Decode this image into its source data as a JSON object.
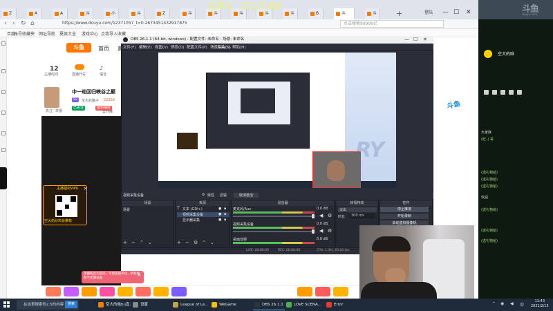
{
  "browser": {
    "tabs": [
      "Z",
      "A",
      "A",
      "斗",
      "小",
      "斗",
      "Z",
      "斗",
      "斗",
      "斗",
      "斗",
      "斗",
      "B",
      "斗",
      "斗"
    ],
    "active_tab": "斗",
    "banner": "在漂店，进几天回家",
    "login_label": "登陆",
    "url": "https://www.douyu.com/12371057_t=0.2673451432917875",
    "search_placeholder": "点击搜索99999亿",
    "bookmarks": [
      "百度",
      "账号收藏夹",
      "网址导航",
      "夏娱大全",
      "游戏中心",
      "点我导入收藏"
    ]
  },
  "douyu": {
    "logo": "斗鱼",
    "nav": [
      "首页",
      "直播"
    ],
    "stats": {
      "count": "12",
      "count_label": "主播时间",
      "live_label": "直播开关",
      "voice_label": "语音"
    },
    "room": {
      "title": "中一劫回归峡谷之巅",
      "badge_level": "92",
      "streamer": "空大的娘子",
      "hot": "22318",
      "tag1": "已关注",
      "tag2": "福利抽奖",
      "follow": "关注",
      "report": "举报",
      "open_room": "去开播"
    },
    "promo": {
      "vip": "主播福利VIP6",
      "text": "空大的炒鸡会推荐"
    },
    "notice": "主播粉丝大回归，可加鱼翅平台，所有福利不定期派送"
  },
  "chat": {
    "user": "空大的晗",
    "lines": [
      "大家族",
      "(旺，) 哥",
      "(送礼物给)",
      "(送礼物给)",
      "(送礼物给)",
      "欢迎",
      "(送礼物给)",
      "(送礼物给)",
      "(送礼物给)"
    ]
  },
  "obs": {
    "title": "OBS 26.1.1 (64-bit, windows) - 配置文件: 未命名 - 场景: 未命名",
    "menu": [
      "文件(F)",
      "编辑(E)",
      "视图(V)",
      "停靠(D)",
      "配置文件(P)",
      "场景集合(S)",
      "工具(T)",
      "帮助(H)"
    ],
    "source_bar": {
      "source": "视频采集设备",
      "properties": "属性",
      "filters": "滤镜",
      "deactivate": "取消激活"
    },
    "panels": {
      "scenes": "场景",
      "sources": "来源",
      "mixer": "混音器",
      "transitions": "转场特效",
      "controls": "控件"
    },
    "scene_items": [
      "场景"
    ],
    "sources": [
      "文本 (GDI+)",
      "视频采集设备",
      "显示器采集"
    ],
    "mixer": [
      {
        "name": "麦克风/Aux",
        "db": "0.0 dB"
      },
      {
        "name": "视频采集设备",
        "db": "0.0 dB"
      },
      {
        "name": "桌面音频",
        "db": "0.0 dB"
      }
    ],
    "transition": {
      "type": "淡出",
      "duration_label": "时长",
      "duration": "300 ms"
    },
    "controls": [
      "停止推流",
      "开始录制",
      "启动虚拟摄像机"
    ],
    "status": {
      "live": "LIVE: 00:00:00",
      "rec": "REC: 00:00:00",
      "cpu": "CPU: 1.0%, 60.00 fps"
    }
  },
  "preview": {
    "watermark": "RY"
  },
  "taskbar": {
    "search": "在这里搜索你2.5的内容",
    "search_btn": "搜索",
    "items": [
      {
        "label": "空大的晗bu直...",
        "color": "#f07d00"
      },
      {
        "label": "设置",
        "color": "#888888"
      },
      {
        "label": "League of Le...",
        "color": "#c8a24a"
      },
      {
        "label": "WeGame",
        "color": "#f5c000"
      },
      {
        "label": "OBS 26.1.1 (...",
        "color": "#333333"
      },
      {
        "label": "LOVE SCENA...",
        "color": "#4caf50"
      },
      {
        "label": "Error",
        "color": "#e53935"
      }
    ],
    "time": "11:43",
    "date": "2021/2/15"
  },
  "right_brand": {
    "logo": "斗鱼",
    "sub": "douyu.com"
  },
  "colors": {
    "accent": "#ff7700",
    "obs_bg": "#2b2e38",
    "taskbar": "#1c2a3a",
    "chat_text": "#9fd27f"
  }
}
